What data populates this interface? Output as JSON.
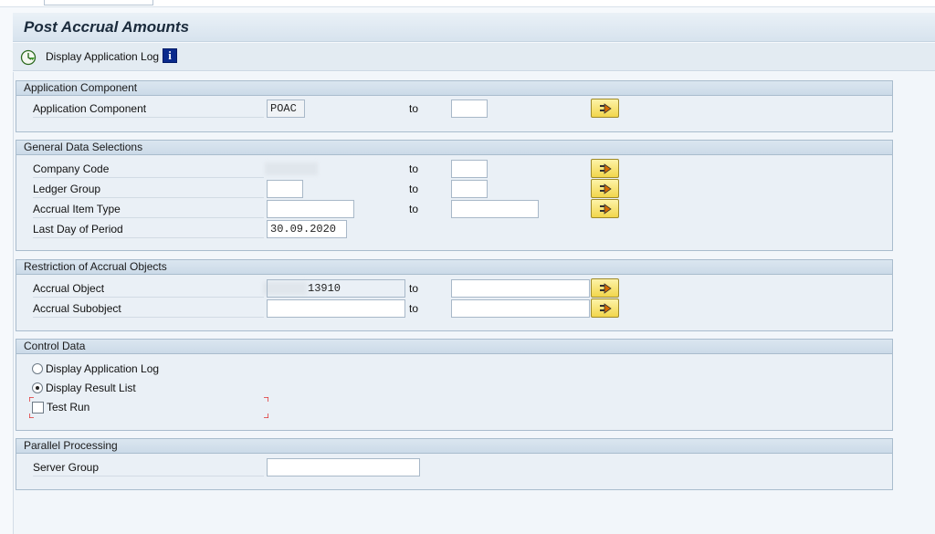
{
  "window": {
    "title": "Post Accrual Amounts"
  },
  "toolbar": {
    "display_log_label": "Display Application Log",
    "info_glyph": "i"
  },
  "common": {
    "to_label": "to"
  },
  "groups": {
    "application_component": {
      "title": "Application Component",
      "rows": [
        {
          "label": "Application Component",
          "low": "POAC",
          "high": ""
        }
      ]
    },
    "general": {
      "title": "General Data Selections",
      "rows": [
        {
          "label": "Company Code",
          "low": "",
          "high": ""
        },
        {
          "label": "Ledger Group",
          "low": "",
          "high": ""
        },
        {
          "label": "Accrual Item Type",
          "low": "",
          "high": ""
        },
        {
          "label": "Last Day of Period",
          "low": "30.09.2020"
        }
      ]
    },
    "restriction": {
      "title": "Restriction of Accrual Objects",
      "rows": [
        {
          "label": "Accrual Object",
          "low": "13910",
          "high": ""
        },
        {
          "label": "Accrual Subobject",
          "low": "",
          "high": ""
        }
      ]
    },
    "control": {
      "title": "Control Data",
      "options": {
        "display_application_log": {
          "label": "Display Application Log",
          "selected": false
        },
        "display_result_list": {
          "label": "Display Result List",
          "selected": true
        },
        "test_run": {
          "label": "Test Run",
          "checked": false
        }
      }
    },
    "parallel": {
      "title": "Parallel Processing",
      "rows": [
        {
          "label": "Server Group",
          "value": ""
        }
      ]
    }
  },
  "colors": {
    "accent_button": "#f2d64c",
    "focus_marker": "#e03030",
    "info_icon": "#0a2a8c"
  }
}
